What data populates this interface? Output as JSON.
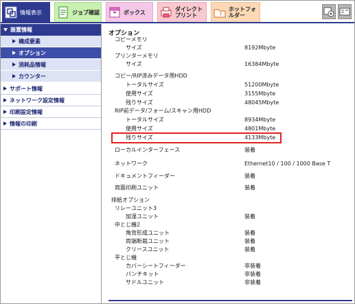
{
  "tabs": [
    {
      "label": "情報表示",
      "icon": "info-display-icon"
    },
    {
      "label": "ジョブ確認",
      "icon": "job-check-icon"
    },
    {
      "label": "ボックス",
      "icon": "box-icon"
    },
    {
      "label": "ダイレクトプリント",
      "icon": "direct-print-icon"
    },
    {
      "label": "ホットフォルダー",
      "icon": "hot-folder-icon"
    }
  ],
  "sidebar": {
    "main": "装置情報",
    "subs": [
      "構成要素",
      "オプション",
      "消耗品情報",
      "カウンター"
    ],
    "tops": [
      "サポート情報",
      "ネットワーク設定情報",
      "印刷設定情報",
      "情報の印刷"
    ]
  },
  "content": {
    "title": "オプション",
    "copy_memory": {
      "label": "コピーメモリ",
      "size_label": "サイズ",
      "size": "8192Mbyte"
    },
    "printer_memory": {
      "label": "プリンターメモリ",
      "size_label": "サイズ",
      "size": "16384Mbyte"
    },
    "hdd1": {
      "label": "コピー/RIP済みデータ用HDD",
      "total_label": "トータルサイズ",
      "total": "51200Mbyte",
      "used_label": "使用サイズ",
      "used": "3155Mbyte",
      "remain_label": "残りサイズ",
      "remain": "48045Mbyte"
    },
    "hdd2": {
      "label": "RIP前データ/フォーム/スキャン用HDD",
      "total_label": "トータルサイズ",
      "total": "8934Mbyte",
      "used_label": "使用サイズ",
      "used": "4801Mbyte",
      "remain_label": "残りサイズ",
      "remain": "4133Mbyte"
    },
    "local_if": {
      "label": "ローカルインターフェース",
      "value": "装着"
    },
    "network": {
      "label": "ネットワーク",
      "value": "Ethernet10 / 100 / 1000 Base T"
    },
    "doc_feeder": {
      "label": "ドキュメントフィーダー",
      "value": "装着"
    },
    "duplex": {
      "label": "両面印刷ユニット",
      "value": "装着"
    },
    "output": {
      "label": "排紙オプション",
      "relay": "リレーユニット3",
      "humid_label": "加湿ユニット",
      "humid": "装着",
      "middle": "中とじ機2",
      "square_label": "角背形成ユニット",
      "square": "装着",
      "trim_label": "両端断裁ユニット",
      "trim": "装着",
      "crease_label": "クリースユニット",
      "crease": "装着",
      "flat": "平とじ機",
      "cover_label": "カバーシートフィーダー",
      "cover": "非装着",
      "punch_label": "パンチキット",
      "punch": "非装着",
      "saddle_label": "サドルユニット",
      "saddle": "非装着"
    }
  },
  "colors": {
    "accent": "#2d3a8f",
    "highlight": "#e02020"
  }
}
